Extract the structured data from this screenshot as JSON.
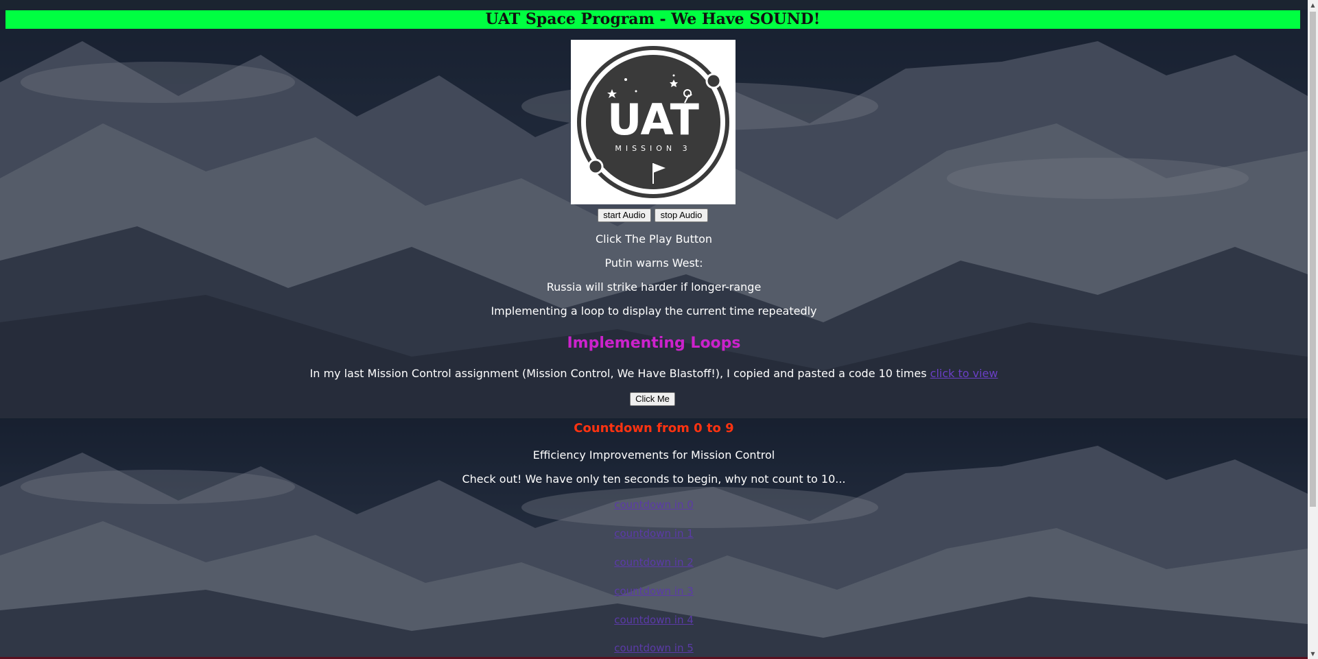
{
  "banner": {
    "title": "UAT Space Program - We Have SOUND!"
  },
  "logo": {
    "main_text": "UAT",
    "sub_text": "MISSION 3"
  },
  "audio": {
    "start_label": "start Audio",
    "stop_label": "stop Audio"
  },
  "lines": {
    "play_hint": "Click The Play Button",
    "news_1": "Putin warns West:",
    "news_2": "Russia will strike harder if longer-range",
    "loop_intro": "Implementing a loop to display the current time repeatedly"
  },
  "loops": {
    "heading": "Implementing Loops",
    "paragraph": "In my last Mission Control assignment (Mission Control, We Have Blastoff!), I copied and pasted a code 10 times",
    "link_text": "click to view",
    "button_label": "Click Me"
  },
  "countdown": {
    "heading": "Countdown from 0 to 9",
    "subheading": "Efficiency Improvements for Mission Control",
    "intro": "Check out! We have only ten seconds to begin, why not count to 10...",
    "links": [
      "countdown in 0",
      "countdown in 1",
      "countdown in 2",
      "countdown in 3",
      "countdown in 4",
      "countdown in 5"
    ]
  },
  "colors": {
    "banner_bg": "#00ff41",
    "heading_magenta": "#cc22cc",
    "heading_red": "#ff3311",
    "link": "#6a3fc6"
  }
}
